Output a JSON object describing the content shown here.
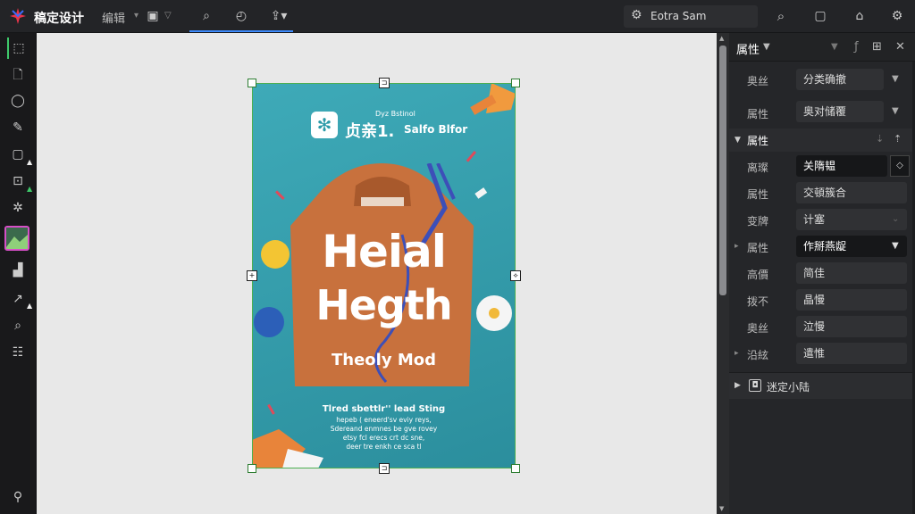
{
  "app": {
    "name": "稿定设计",
    "edit_menu": "编辑"
  },
  "account": {
    "name": "Eotra Sam"
  },
  "tools": [
    "select-tool",
    "page-tool",
    "comment-tool",
    "pen-tool",
    "frame-tool",
    "crop-tool",
    "effects-tool",
    "image-tool",
    "chart-tool",
    "path-tool",
    "zoom-tool",
    "calendar-tool",
    "bottom-tool"
  ],
  "poster": {
    "brand_small": "Dyz Bstinol",
    "brand_big": "贞亲1.",
    "brand_sub": "Salfo Blfor",
    "headline_1": "Heial",
    "headline_2": "Hegth",
    "headline_3": "Theoly Mod",
    "caption_title": "Tlred sbettlr'' lead Sting",
    "caption_lines": [
      "hepeb ( eneerd'sv eviy reys,",
      "Sdereand enmnes be gve rovey",
      "etsy fcl erecs crt dc sne,",
      "deer tre enkh ce sca tl"
    ]
  },
  "panel": {
    "title": "属性",
    "rows_top": [
      {
        "label": "奥丝",
        "value": "分类确撤"
      },
      {
        "label": "属性",
        "value": "奥对储覆"
      }
    ],
    "section": "属性",
    "rows": [
      {
        "label": "离璨",
        "value": "关隋韫",
        "dark": true
      },
      {
        "label": "属性",
        "value": "交頓簇合",
        "dark": false
      },
      {
        "label": "变牌",
        "value": "计塞",
        "dark": false
      },
      {
        "label": "属性",
        "value": "作掰燕龊",
        "dark": true
      },
      {
        "label": "高價",
        "value": "简佳",
        "dark": false
      },
      {
        "label": "拨不",
        "value": "晶慢",
        "dark": false
      },
      {
        "label": "奧丝",
        "value": "泣慢",
        "dark": false
      },
      {
        "label": "沿絃",
        "value": "遣惟",
        "dark": false
      }
    ],
    "subsection": "迷定小陆"
  }
}
